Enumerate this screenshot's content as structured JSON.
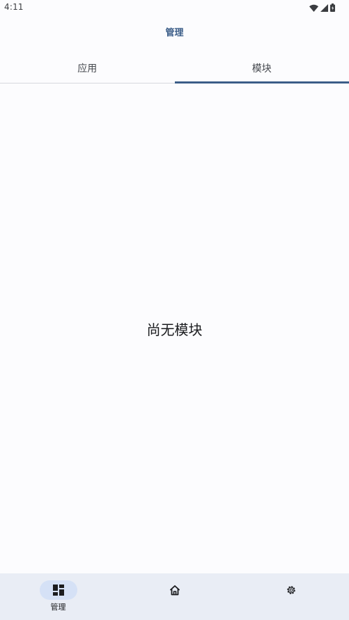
{
  "status_bar": {
    "time": "4:11"
  },
  "header": {
    "title": "管理"
  },
  "tabs": [
    {
      "label": "应用",
      "active": false
    },
    {
      "label": "模块",
      "active": true
    }
  ],
  "main": {
    "empty_message": "尚无模块"
  },
  "bottom_nav": {
    "items": [
      {
        "label": "管理",
        "icon": "dashboard-icon",
        "selected": true
      },
      {
        "label": "",
        "icon": "home-icon",
        "selected": false
      },
      {
        "label": "",
        "icon": "gear-icon",
        "selected": false
      }
    ]
  },
  "colors": {
    "accent": "#3b5d88",
    "background": "#fcfcfe",
    "nav_background": "#e9edf5",
    "nav_indicator": "#d5e1f6"
  }
}
